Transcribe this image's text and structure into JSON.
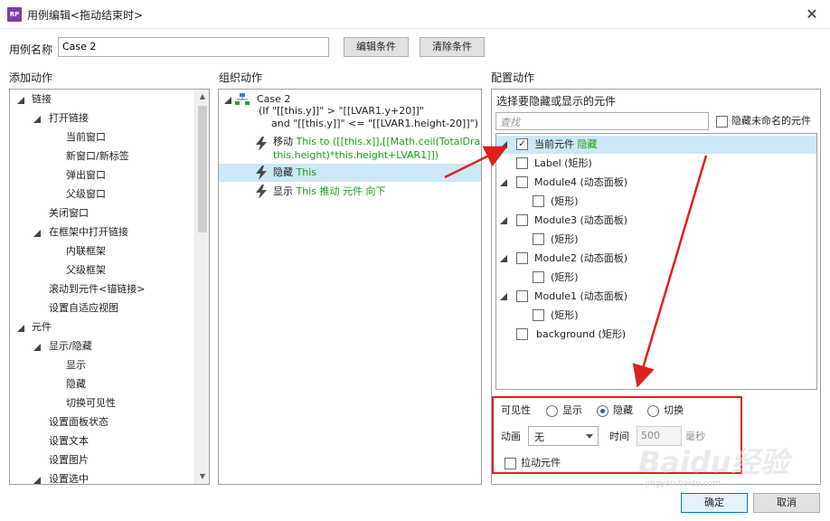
{
  "window": {
    "app_icon": "RP",
    "title": "用例编辑<拖动结束时>",
    "close_icon": "close-icon"
  },
  "case_name": {
    "label": "用例名称",
    "value": "Case 2"
  },
  "toolbar": {
    "edit_conditions": "编辑条件",
    "clear_conditions": "清除条件"
  },
  "add_actions": {
    "title": "添加动作",
    "items": [
      "链接",
      "打开链接",
      "当前窗口",
      "新窗口/新标签",
      "弹出窗口",
      "父级窗口",
      "关闭窗口",
      "在框架中打开链接",
      "内联框架",
      "父级框架",
      "滚动到元件<锚链接>",
      "设置自适应视图",
      "元件",
      "显示/隐藏",
      "显示",
      "隐藏",
      "切换可见性",
      "设置面板状态",
      "设置文本",
      "设置图片",
      "设置选中"
    ]
  },
  "organize_actions": {
    "title": "组织动作",
    "case_title": "Case 2",
    "condition_line1": "(If \"[[this.y]]\" > \"[[LVAR1.y+20]]\"",
    "condition_line2": "and \"[[this.y]]\" <= \"[[LVAR1.height-20]]\")",
    "move_label": "移动",
    "move_detail1": "This to ([[this.x]],[[Math.ceil(TotalDragY/",
    "move_detail2": "this.height)*this.height+LVAR1]])",
    "hide_label": "隐藏",
    "hide_detail": "This",
    "show_label": "显示",
    "show_detail": "This 推动 元件 向下"
  },
  "config_actions": {
    "title": "配置动作",
    "subtitle": "选择要隐藏或显示的元件",
    "search_placeholder": "查找",
    "hide_unnamed": "隐藏未命名的元件",
    "widgets": [
      {
        "label": "当前元件",
        "suffix": "隐藏",
        "checked": true
      },
      {
        "label": "Label (矩形)"
      },
      {
        "label": "Module4 (动态面板)"
      },
      {
        "label": "(矩形)"
      },
      {
        "label": "Module3 (动态面板)"
      },
      {
        "label": "(矩形)"
      },
      {
        "label": "Module2 (动态面板)"
      },
      {
        "label": "(矩形)"
      },
      {
        "label": "Module1 (动态面板)"
      },
      {
        "label": "(矩形)"
      },
      {
        "label": "background (矩形)"
      }
    ],
    "visibility": {
      "label": "可见性",
      "show": "显示",
      "hide": "隐藏",
      "toggle": "切换",
      "selected": "隐藏"
    },
    "animation": {
      "label": "动画",
      "value": "无",
      "time_label": "时间",
      "time_value": "500",
      "unit": "毫秒"
    },
    "push_widgets": "拉动元件"
  },
  "footer": {
    "ok": "确定",
    "cancel": "取消"
  },
  "watermark": {
    "text": "Baidu经验",
    "url": "jingyan.baidu.com"
  },
  "colors": {
    "selection": "#cce8f4",
    "action_detail": "#19a119",
    "annotation_red": "#e0201c",
    "app_icon": "#7b3fa0"
  }
}
